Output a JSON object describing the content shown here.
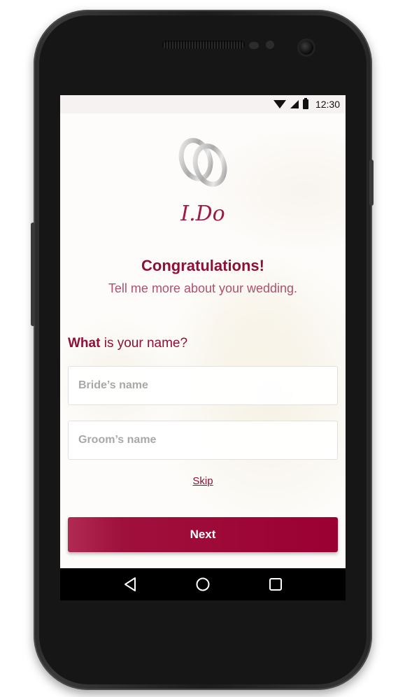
{
  "status_bar": {
    "time": "12:30",
    "icons": [
      "wifi-icon",
      "signal-icon",
      "battery-icon"
    ]
  },
  "app": {
    "logo_text": "I.Do",
    "logo_icon": "wedding-rings-icon"
  },
  "heading": {
    "title": "Congratulations!",
    "subtitle": "Tell me more about your wedding."
  },
  "form": {
    "question_bold": "What",
    "question_rest": " is your name?",
    "bride_field": {
      "value": "",
      "placeholder": "Bride’s name"
    },
    "groom_field": {
      "value": "",
      "placeholder": "Groom’s name"
    },
    "skip_label": "Skip",
    "next_label": "Next"
  },
  "nav_bar": {
    "icons": [
      "back-icon",
      "home-icon",
      "recents-icon"
    ]
  },
  "colors": {
    "accent": "#9b0033",
    "title": "#8f1037",
    "subtitle": "#b0506e"
  }
}
